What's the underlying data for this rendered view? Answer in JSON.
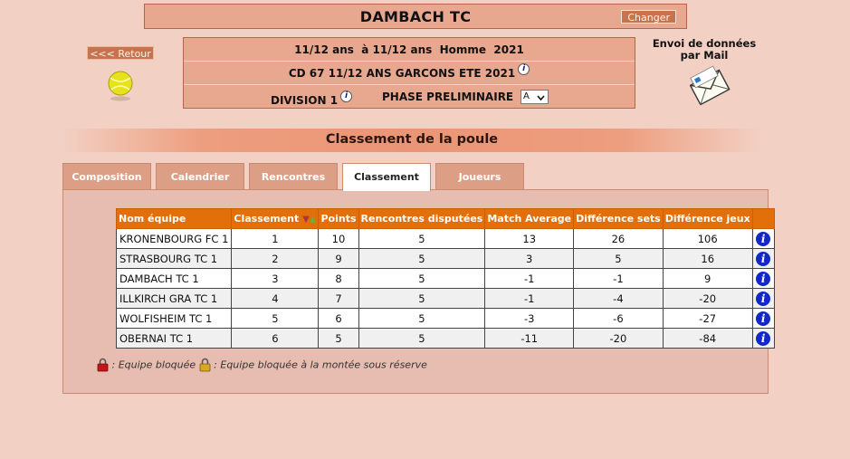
{
  "header": {
    "club_name": "DAMBACH TC",
    "change_label": "Changer"
  },
  "nav": {
    "back_label": "<<< Retour"
  },
  "info": {
    "category": "11/12 ans  à 11/12 ans  Homme  2021",
    "championship": "CD 67 11/12 ANS GARCONS ETE 2021",
    "division": "DIVISION 1",
    "phase": "PHASE PRELIMINAIRE",
    "phase_select": "A"
  },
  "mail": {
    "label": "Envoi de données par Mail"
  },
  "section_title": "Classement de la poule",
  "tabs": [
    {
      "label": "Composition",
      "active": false
    },
    {
      "label": "Calendrier",
      "active": false
    },
    {
      "label": "Rencontres",
      "active": false
    },
    {
      "label": "Classement",
      "active": true
    },
    {
      "label": "Joueurs",
      "active": false
    }
  ],
  "table": {
    "headers": {
      "team": "Nom équipe",
      "rank": "Classement",
      "points": "Points",
      "played": "Rencontres disputées",
      "average": "Match Average",
      "sets": "Différence sets",
      "games": "Différence jeux"
    },
    "rows": [
      {
        "team": "KRONENBOURG FC 1",
        "rank": "1",
        "points": "10",
        "played": "5",
        "average": "13",
        "sets": "26",
        "games": "106"
      },
      {
        "team": "STRASBOURG TC 1",
        "rank": "2",
        "points": "9",
        "played": "5",
        "average": "3",
        "sets": "5",
        "games": "16"
      },
      {
        "team": "DAMBACH TC 1",
        "rank": "3",
        "points": "8",
        "played": "5",
        "average": "-1",
        "sets": "-1",
        "games": "9"
      },
      {
        "team": "ILLKIRCH GRA TC 1",
        "rank": "4",
        "points": "7",
        "played": "5",
        "average": "-1",
        "sets": "-4",
        "games": "-20"
      },
      {
        "team": "WOLFISHEIM TC 1",
        "rank": "5",
        "points": "6",
        "played": "5",
        "average": "-3",
        "sets": "-6",
        "games": "-27"
      },
      {
        "team": "OBERNAI TC 1",
        "rank": "6",
        "points": "5",
        "played": "5",
        "average": "-11",
        "sets": "-20",
        "games": "-84"
      }
    ]
  },
  "legend": {
    "blocked": ": Equipe bloquée",
    "blocked_up": ": Equipe bloquée à la montée sous réserve"
  },
  "colors": {
    "accent": "#e26f0a",
    "panel": "#e6bdb0",
    "background": "#f2d0c4",
    "info_icon": "#1428c8"
  },
  "icons": [
    "info-icon",
    "tennis-ball-icon",
    "mail-envelope-icon",
    "red-lock-icon",
    "gold-lock-icon",
    "sort-down-icon",
    "sort-up-icon",
    "chevron-down-icon"
  ]
}
